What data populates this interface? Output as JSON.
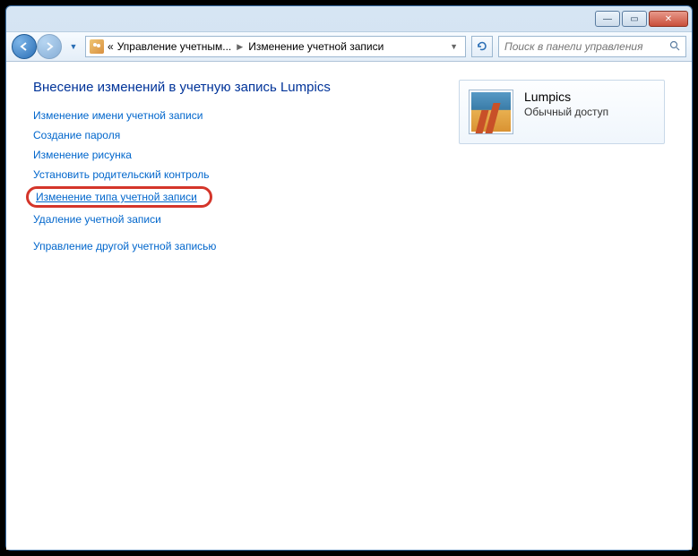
{
  "titlebar": {},
  "nav": {
    "breadcrumb_prefix": "«",
    "crumb1": "Управление учетным...",
    "crumb2": "Изменение учетной записи",
    "search_placeholder": "Поиск в панели управления"
  },
  "main": {
    "heading": "Внесение изменений в учетную запись Lumpics",
    "links": {
      "rename": "Изменение имени учетной записи",
      "create_pw": "Создание пароля",
      "change_pic": "Изменение рисунка",
      "parental": "Установить родительский контроль",
      "change_type": "Изменение типа учетной записи",
      "delete": "Удаление учетной записи",
      "manage_other": "Управление другой учетной записью"
    }
  },
  "user": {
    "name": "Lumpics",
    "role": "Обычный доступ"
  }
}
